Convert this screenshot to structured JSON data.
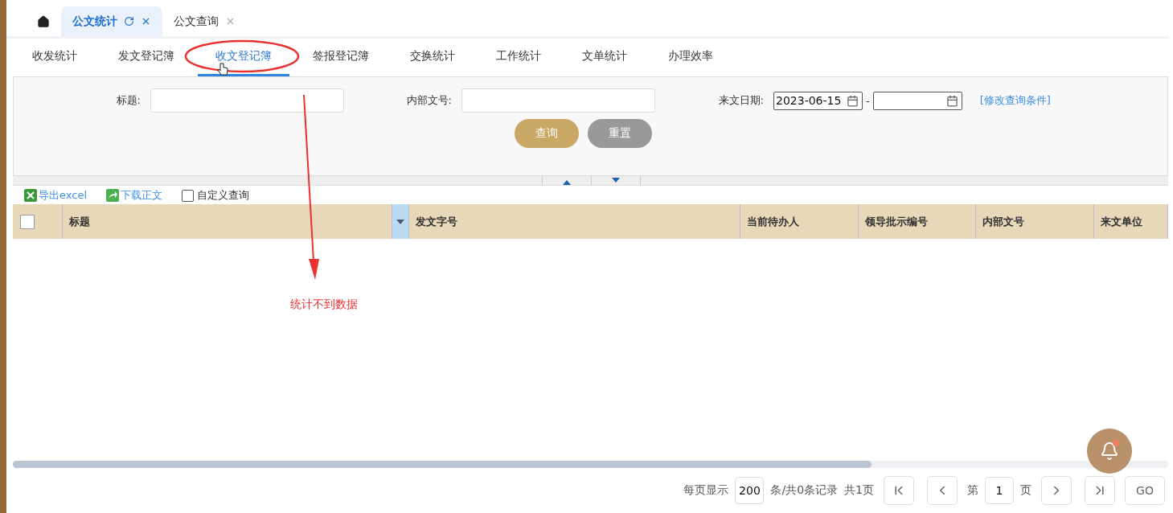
{
  "top_tabs": [
    {
      "label": "公文统计",
      "selected": true,
      "refreshable": true
    },
    {
      "label": "公文查询",
      "selected": false,
      "refreshable": false
    }
  ],
  "sub_tabs": [
    {
      "label": "收发统计",
      "selected": false
    },
    {
      "label": "发文登记簿",
      "selected": false
    },
    {
      "label": "收文登记簿",
      "selected": true
    },
    {
      "label": "签报登记簿",
      "selected": false
    },
    {
      "label": "交换统计",
      "selected": false
    },
    {
      "label": "工作统计",
      "selected": false
    },
    {
      "label": "文单统计",
      "selected": false
    },
    {
      "label": "办理效率",
      "selected": false
    }
  ],
  "query": {
    "fields": [
      {
        "label": "标题:"
      },
      {
        "label": "内部文号:"
      }
    ],
    "date": {
      "label": "来文日期:",
      "from": "2023-06-15",
      "separator": "-"
    },
    "link": "[修改查询条件]",
    "buttons": [
      {
        "label": "查询",
        "kind": "primary"
      },
      {
        "label": "重置",
        "kind": "secondary"
      }
    ]
  },
  "toolbar": [
    {
      "kind": "excel",
      "label": "导出excel"
    },
    {
      "kind": "download",
      "label": "下载正文"
    },
    {
      "kind": "checkbox",
      "label": "自定义查询",
      "checked": false
    }
  ],
  "table": {
    "select_all_checked": false,
    "columns": [
      "标题",
      "发文字号",
      "当前待办人",
      "领导批示编号",
      "内部文号",
      "来文单位"
    ]
  },
  "annotation": {
    "text": "统计不到数据"
  },
  "pager": {
    "per_page_label": "每页显示",
    "per_page": "200",
    "summary": "条/共0条记录",
    "pages": "共1页",
    "page_prefix": "第",
    "page": "1",
    "page_suffix": "页",
    "go": "GO"
  }
}
